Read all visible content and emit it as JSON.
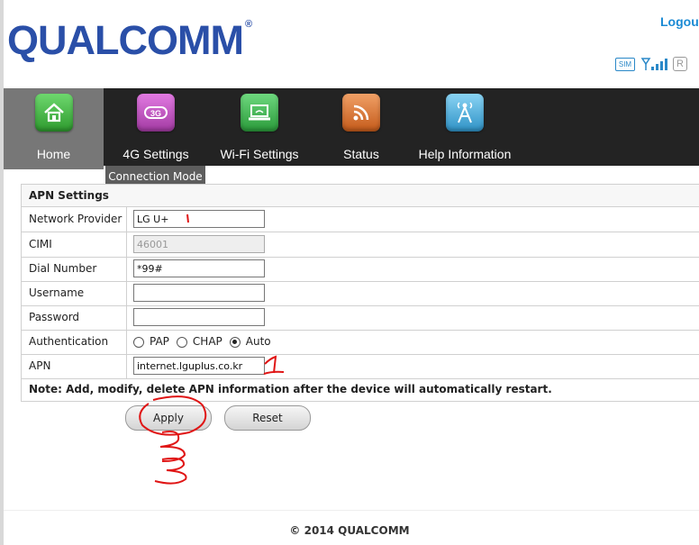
{
  "header": {
    "logo_text": "QUALCOMM",
    "logo_mark": "®",
    "logout_label": "Logou",
    "status_icons": {
      "sim": "SIM",
      "roaming": "R"
    }
  },
  "nav": {
    "items": [
      {
        "label": "Home",
        "icon": "home-icon",
        "color": "#3aa63a",
        "active": true
      },
      {
        "label": "4G Settings",
        "icon": "4g-icon",
        "color": "#b545b5"
      },
      {
        "label": "Wi-Fi Settings",
        "icon": "wifi-laptop-icon",
        "color": "#2f9a3f"
      },
      {
        "label": "Status",
        "icon": "rss-icon",
        "color": "#d9762a"
      },
      {
        "label": "Help Information",
        "icon": "antenna-icon",
        "color": "#3aa6d6"
      }
    ],
    "submenu_label": "Connection Mode"
  },
  "apn": {
    "title": "APN Settings",
    "network_provider": {
      "label": "Network Provider",
      "value": "LG U+"
    },
    "cimi": {
      "label": "CIMI",
      "value": "46001"
    },
    "dial_number": {
      "label": "Dial Number",
      "value": "*99#"
    },
    "username": {
      "label": "Username",
      "value": ""
    },
    "password": {
      "label": "Password",
      "value": ""
    },
    "authentication": {
      "label": "Authentication",
      "options": [
        "PAP",
        "CHAP",
        "Auto"
      ],
      "selected": "Auto"
    },
    "apn": {
      "label": "APN",
      "value": "internet.lguplus.co.kr"
    },
    "note": "Note: Add, modify, delete APN information after the device will automatically restart."
  },
  "buttons": {
    "apply": "Apply",
    "reset": "Reset"
  },
  "footer": {
    "copyright": "© 2014 QUALCOMM"
  },
  "annotations": {
    "marks": [
      "1",
      "2",
      "3"
    ],
    "color": "#e01515"
  }
}
